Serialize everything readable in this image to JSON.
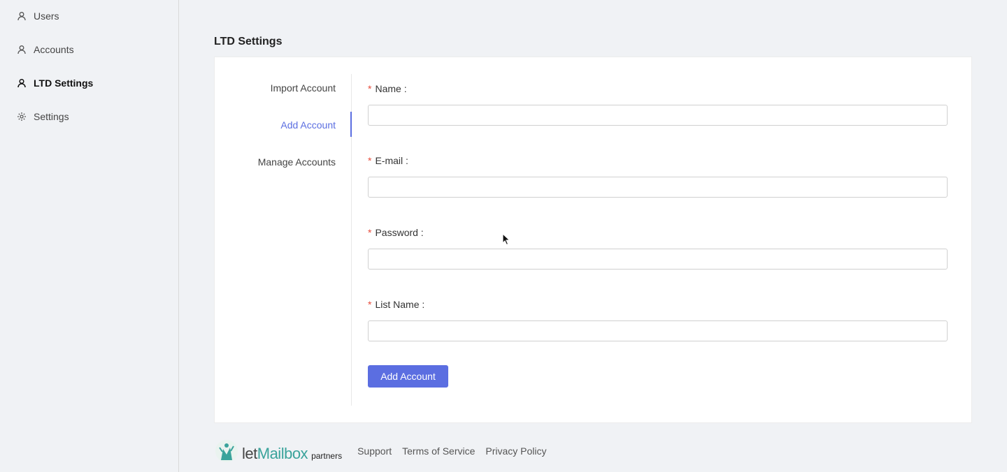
{
  "sidebar": {
    "items": [
      {
        "label": "Users",
        "icon": "user-icon",
        "active": false
      },
      {
        "label": "Accounts",
        "icon": "user-icon",
        "active": false
      },
      {
        "label": "LTD Settings",
        "icon": "user-icon",
        "active": true
      },
      {
        "label": "Settings",
        "icon": "gear-icon",
        "active": false
      }
    ]
  },
  "page": {
    "title": "LTD Settings"
  },
  "tabs": [
    {
      "label": "Import Account",
      "active": false
    },
    {
      "label": "Add Account",
      "active": true
    },
    {
      "label": "Manage Accounts",
      "active": false
    }
  ],
  "form": {
    "required_mark": "*",
    "fields": [
      {
        "label": "Name :",
        "value": "",
        "placeholder": ""
      },
      {
        "label": "E-mail :",
        "value": "",
        "placeholder": ""
      },
      {
        "label": "Password :",
        "value": "",
        "placeholder": ""
      },
      {
        "label": "List Name :",
        "value": "",
        "placeholder": ""
      }
    ],
    "submit_label": "Add Account"
  },
  "footer": {
    "logo_let": "let",
    "logo_mailbox": "Mailbox",
    "logo_partners": "partners",
    "links": [
      "Support",
      "Terms of Service",
      "Privacy Policy"
    ]
  },
  "colors": {
    "accent": "#5b6ee1",
    "required": "#e74c3c",
    "logo_green": "#3aa39b"
  }
}
